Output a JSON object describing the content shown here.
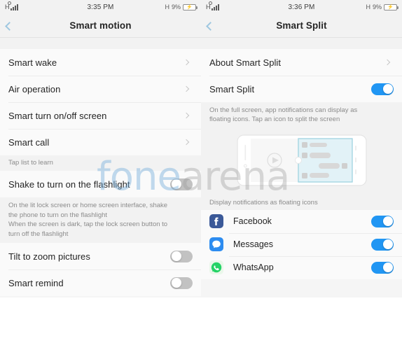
{
  "left": {
    "status": {
      "network": "H",
      "time": "3:35 PM",
      "battery_label": "H",
      "battery_pct": "9%",
      "charging_icon": "lightning-bolt-icon"
    },
    "title": "Smart motion",
    "back_icon": "chevron-left-icon",
    "items": [
      {
        "label": "Smart wake",
        "type": "chevron"
      },
      {
        "label": "Air operation",
        "type": "chevron"
      },
      {
        "label": "Smart turn on/off screen",
        "type": "chevron"
      },
      {
        "label": "Smart call",
        "type": "chevron"
      }
    ],
    "hint": "Tap list to learn",
    "shake": {
      "label": "Shake to turn on the flashlight",
      "on": false
    },
    "shake_desc_line1": "On the lit lock screen or home screen interface, shake",
    "shake_desc_line2": "the phone to turn on the flashlight",
    "shake_desc_line3": "When the screen is dark, tap the lock screen button to",
    "shake_desc_line4": "turn off the flashlight",
    "tilt": {
      "label": "Tilt to zoom pictures",
      "on": false
    },
    "remind": {
      "label": "Smart remind",
      "on": false
    }
  },
  "right": {
    "status": {
      "network": "H",
      "time": "3:36 PM",
      "battery_label": "H",
      "battery_pct": "9%",
      "charging_icon": "lightning-bolt-icon"
    },
    "title": "Smart Split",
    "back_icon": "chevron-left-icon",
    "about": {
      "label": "About Smart Split",
      "type": "chevron"
    },
    "toggle": {
      "label": "Smart Split",
      "on": true
    },
    "desc_line1": "On the full screen, app notifications can display as",
    "desc_line2": "floating icons. Tap an icon to split the screen",
    "illustration_name": "split-screen-phone-illustration",
    "section_label": "Display notifications as floating icons",
    "apps": [
      {
        "name": "Facebook",
        "icon": "facebook-icon",
        "color": "#3b5998",
        "on": true
      },
      {
        "name": "Messages",
        "icon": "messages-bubble-icon",
        "color": "#2d8cf0",
        "on": true
      },
      {
        "name": "WhatsApp",
        "icon": "whatsapp-icon",
        "color": "#25d366",
        "on": true
      }
    ]
  },
  "watermark": {
    "part1": "fone",
    "part2": "arena"
  },
  "colors": {
    "accent": "#2196f3",
    "switch_off": "#c2c2c2",
    "panel_bg": "#f2f2f2",
    "row_bg": "#fafafa"
  }
}
